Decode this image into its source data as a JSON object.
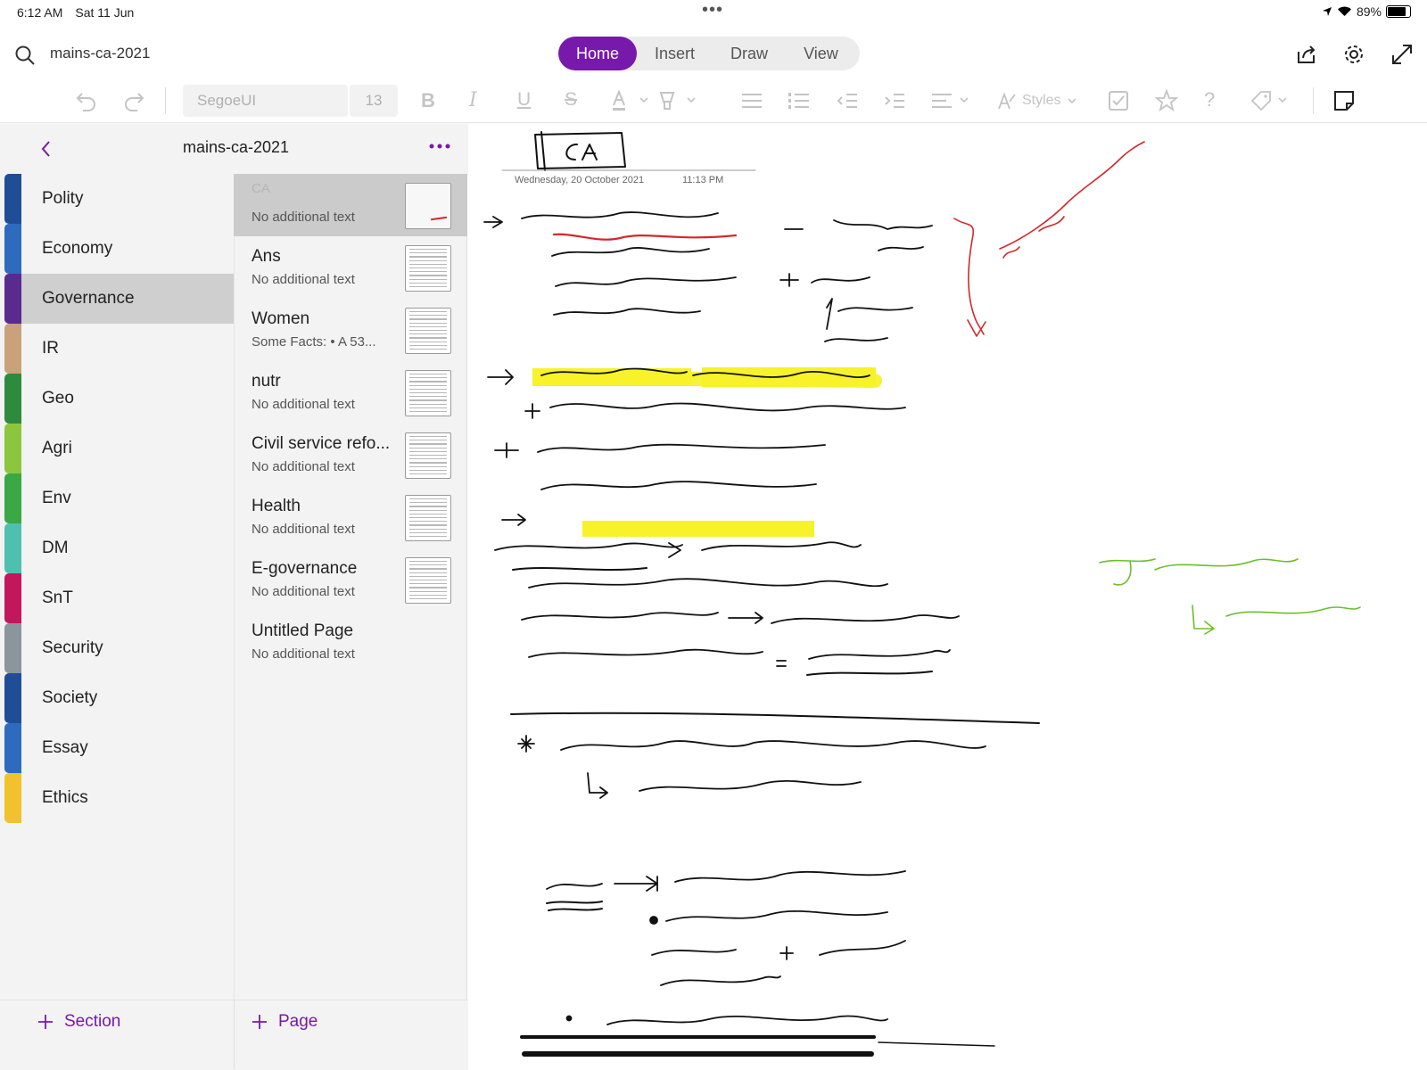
{
  "status": {
    "time": "6:12 AM",
    "date": "Sat 11 Jun",
    "battery": "89%"
  },
  "notebook": {
    "search_text": "mains-ca-2021",
    "panel_title": "mains-ca-2021"
  },
  "tabs": [
    {
      "label": "Home",
      "active": true
    },
    {
      "label": "Insert",
      "active": false
    },
    {
      "label": "Draw",
      "active": false
    },
    {
      "label": "View",
      "active": false
    }
  ],
  "toolbar": {
    "font": "SegoeUI",
    "size": "13",
    "styles_label": "Styles"
  },
  "sections": [
    {
      "label": "Polity",
      "color": "#1f4e96"
    },
    {
      "label": "Economy",
      "color": "#2e6bbf"
    },
    {
      "label": "Governance",
      "color": "#5b2a8e",
      "selected": true
    },
    {
      "label": "IR",
      "color": "#c9a17a"
    },
    {
      "label": "Geo",
      "color": "#2e8b3e"
    },
    {
      "label": "Agri",
      "color": "#8cc63f"
    },
    {
      "label": "Env",
      "color": "#3aa845"
    },
    {
      "label": "DM",
      "color": "#4fc0b0"
    },
    {
      "label": "SnT",
      "color": "#c2185b"
    },
    {
      "label": "Security",
      "color": "#8d959c"
    },
    {
      "label": "Society",
      "color": "#1f4e96"
    },
    {
      "label": "Essay",
      "color": "#2e6bbf"
    },
    {
      "label": "Ethics",
      "color": "#f2c12e"
    }
  ],
  "pages": [
    {
      "title": "CA",
      "subtitle": "No additional text",
      "selected": true
    },
    {
      "title": "Ans",
      "subtitle": "No additional text"
    },
    {
      "title": "Women",
      "subtitle": "Some Facts:  • A 53..."
    },
    {
      "title": "nutr",
      "subtitle": "No additional text"
    },
    {
      "title": "Civil service refo...",
      "subtitle": "No additional text"
    },
    {
      "title": "Health",
      "subtitle": "No additional text"
    },
    {
      "title": "E-governance",
      "subtitle": "No additional text"
    },
    {
      "title": "Untitled Page",
      "subtitle": "No additional text"
    }
  ],
  "bottom": {
    "add_section": "Section",
    "add_page": "Page"
  },
  "note": {
    "date": "Wednesday, 20 October 2021",
    "time": "11:13 PM"
  },
  "colors": {
    "accent": "#7719aa",
    "ink_red": "#d4282b",
    "ink_green": "#6cbf2b",
    "highlight": "#f7f22a"
  }
}
